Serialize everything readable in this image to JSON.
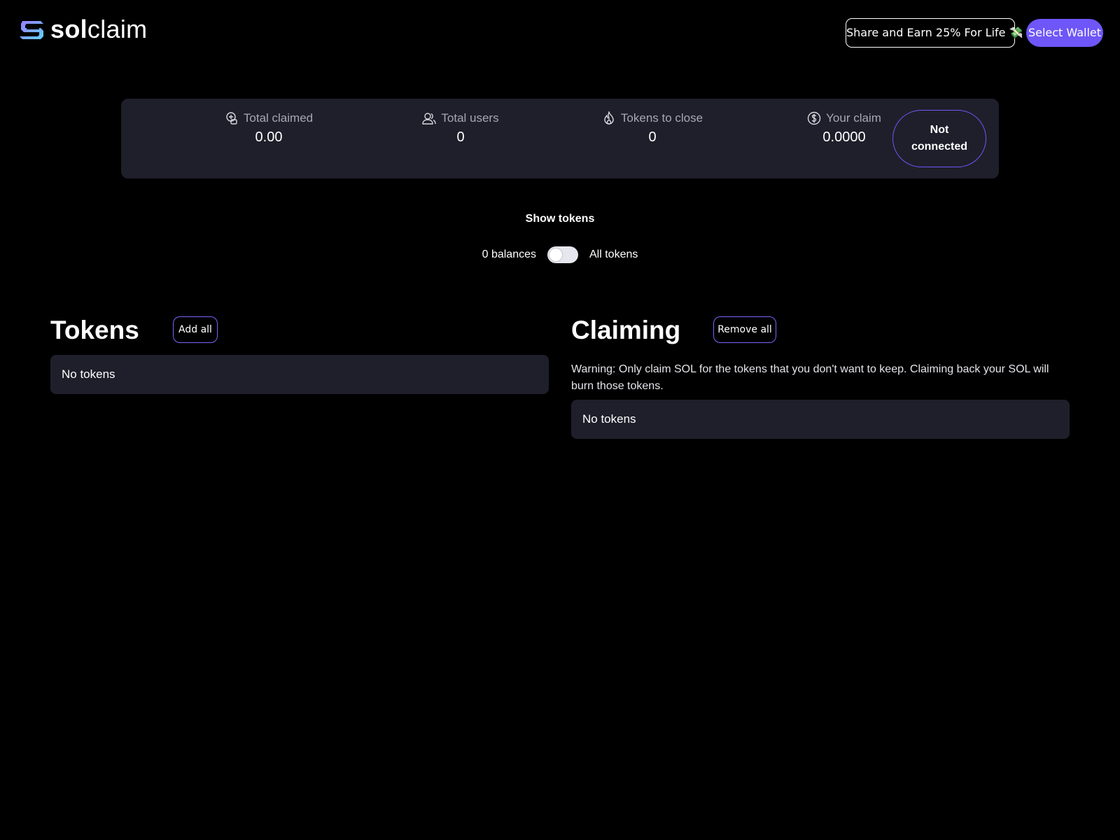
{
  "header": {
    "logo_sol": "sol",
    "logo_claim": "claim",
    "share_label": "Share and Earn 25% For Life 💸",
    "wallet_label": "Select Wallet",
    "accent_color": "#6e56f8"
  },
  "stats": {
    "total_claimed": {
      "label": "Total claimed",
      "value": "0.00",
      "icon": "coins-icon"
    },
    "total_users": {
      "label": "Total users",
      "value": "0",
      "icon": "users-icon"
    },
    "tokens_to_close": {
      "label": "Tokens to close",
      "value": "0",
      "icon": "flame-icon"
    },
    "your_claim": {
      "label": "Your claim",
      "value": "0.0000",
      "icon": "dollar-circle-icon"
    },
    "status": "Not connected"
  },
  "filter": {
    "title": "Show tokens",
    "left_label": "0 balances",
    "right_label": "All tokens",
    "toggle_on": false
  },
  "tokens": {
    "title": "Tokens",
    "button_label": "Add all",
    "empty_text": "No tokens"
  },
  "claiming": {
    "title": "Claiming",
    "button_label": "Remove all",
    "warning": "Warning: Only claim SOL for the tokens that you don't want to keep. Claiming back your SOL will burn those tokens.",
    "empty_text": "No tokens"
  }
}
